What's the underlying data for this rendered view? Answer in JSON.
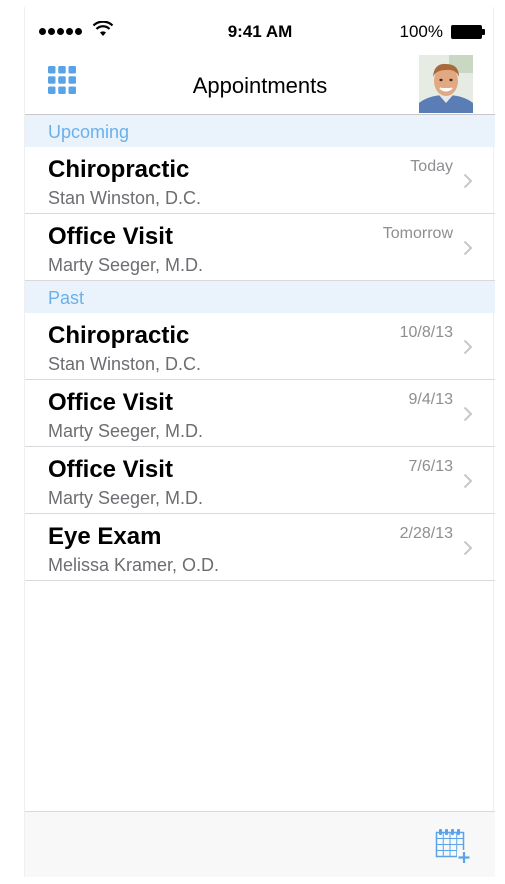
{
  "status_bar": {
    "time": "9:41 AM",
    "battery": "100%"
  },
  "nav": {
    "title": "Appointments",
    "left_icon": "grid-icon",
    "right_icon": "avatar"
  },
  "sections": [
    {
      "header": "Upcoming",
      "rows": [
        {
          "title": "Chiropractic",
          "subtitle": "Stan Winston, D.C.",
          "date": "Today"
        },
        {
          "title": "Office Visit",
          "subtitle": "Marty Seeger, M.D.",
          "date": "Tomorrow"
        }
      ]
    },
    {
      "header": "Past",
      "rows": [
        {
          "title": "Chiropractic",
          "subtitle": "Stan Winston, D.C.",
          "date": "10/8/13"
        },
        {
          "title": "Office Visit",
          "subtitle": "Marty Seeger, M.D.",
          "date": "9/4/13"
        },
        {
          "title": "Office Visit",
          "subtitle": "Marty Seeger, M.D.",
          "date": "7/6/13"
        },
        {
          "title": "Eye Exam",
          "subtitle": "Melissa Kramer, O.D.",
          "date": "2/28/13"
        }
      ]
    }
  ],
  "toolbar": {
    "add_icon": "add-calendar-icon"
  },
  "colors": {
    "accent": "#5aa3e6",
    "section_bg": "#eaf3fc",
    "section_text": "#6ab0ea"
  }
}
